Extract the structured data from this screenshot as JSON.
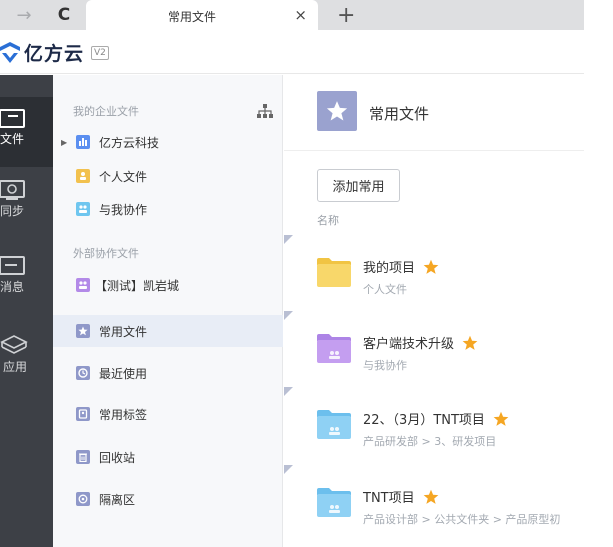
{
  "browser": {
    "tab_title": "常用文件",
    "close_glyph": "×",
    "new_tab_glyph": "+",
    "forward_glyph": "→",
    "reload_glyph": "C"
  },
  "header": {
    "logo_text": "亿方云",
    "version": "V2"
  },
  "rail": {
    "items": [
      {
        "label": "文件",
        "icon": "file-icon",
        "active": true
      },
      {
        "label": "同步",
        "icon": "sync-icon",
        "active": false
      },
      {
        "label": "消息",
        "icon": "message-icon",
        "active": false
      },
      {
        "label": "应用",
        "icon": "apps-icon",
        "active": false
      }
    ]
  },
  "tree": {
    "section_enterprise": "我的企业文件",
    "section_external": "外部协作文件",
    "items": [
      {
        "label": "亿方云科技",
        "icon": "org-chart-icon",
        "color": "#5b8ff0"
      },
      {
        "label": "个人文件",
        "icon": "person-icon",
        "color": "#f2c14e"
      },
      {
        "label": "与我协作",
        "icon": "collab-icon",
        "color": "#6fc6ef"
      },
      {
        "label": "【测试】凯岩城",
        "icon": "collab-icon",
        "color": "#b38ae8"
      },
      {
        "label": "常用文件",
        "icon": "star-icon",
        "color": "#8f98c9"
      },
      {
        "label": "最近使用",
        "icon": "clock-icon",
        "color": "#8f98c9"
      },
      {
        "label": "常用标签",
        "icon": "tag-icon",
        "color": "#8f98c9"
      },
      {
        "label": "回收站",
        "icon": "trash-icon",
        "color": "#8f98c9"
      },
      {
        "label": "隔离区",
        "icon": "quarantine-icon",
        "color": "#8f98c9"
      }
    ]
  },
  "main": {
    "title": "常用文件",
    "add_button": "添加常用",
    "column_name": "名称",
    "rows": [
      {
        "title": "我的项目",
        "sub": "个人文件",
        "folder_color": "#f8d76a",
        "folder_tab": "#f1c443",
        "collab": false
      },
      {
        "title": "客户端技术升级",
        "sub": "与我协作",
        "folder_color": "#c49ef0",
        "folder_tab": "#ad84e6",
        "collab": true
      },
      {
        "title": "22、（3月）TNT项目",
        "sub": "产品研发部 > 3、研发项目",
        "folder_color": "#8fd1f4",
        "folder_tab": "#6cbfed",
        "collab": true
      },
      {
        "title": "TNT项目",
        "sub": "产品设计部 > 公共文件夹 > 产品原型初",
        "folder_color": "#8fd1f4",
        "folder_tab": "#6cbfed",
        "collab": true
      }
    ]
  },
  "colors": {
    "rail_bg": "#3d4046",
    "rail_active": "#2c2f34",
    "star": "#f5a623",
    "accent": "#2a6fd6"
  }
}
